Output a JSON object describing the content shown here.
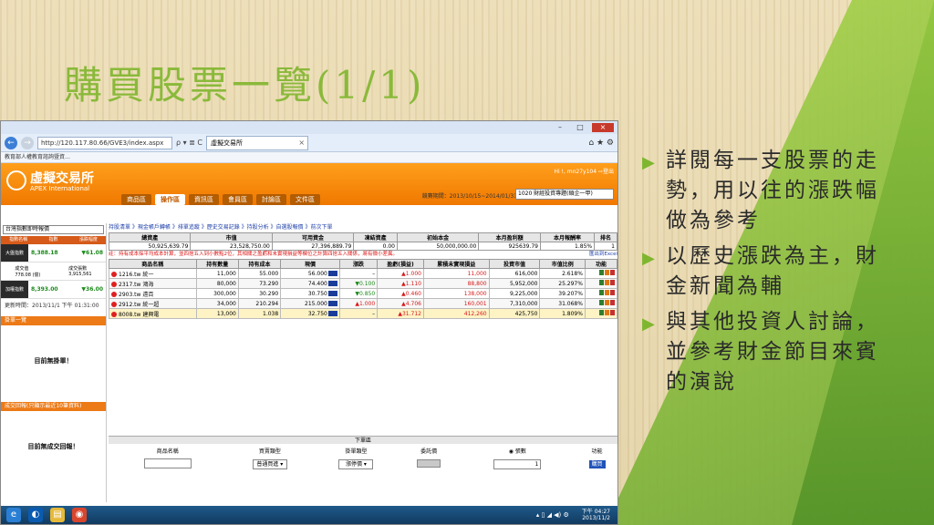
{
  "slide": {
    "title": "購買股票一覽(1/1)",
    "bullets": [
      "詳閱每一支股票的走勢，用以往的漲跌幅做為參考",
      "以歷史漲跌為主，財金新聞為輔",
      "與其他投資人討論，並參考財金節目來賓的演說"
    ]
  },
  "browser": {
    "url": "http://120.117.80.66/GVE3/index.aspx",
    "url_tools": "ρ ▾ ≣ C",
    "tab_title": "虛擬交易所",
    "favorites_text": "教育部人權教育諮詢暨資…",
    "window_buttons": [
      "–",
      "□",
      "×"
    ]
  },
  "site": {
    "logo_name": "虛擬交易所",
    "logo_sub": "APEX International",
    "user_text": "Hi !, mn27y104  ⇨登出",
    "date_range": "競賽期間：2013/10/15~2014/01/31",
    "competition": "1020 財經投資專題(碩企一甲)",
    "menu": [
      "商品區",
      "操作區",
      "資訊區",
      "會員區",
      "討論區",
      "文件區"
    ],
    "active_menu": "操作區"
  },
  "sidebar": {
    "select": "台灣指數即時報價",
    "headers": [
      "指數名稱",
      "指數",
      "漲跌幅度"
    ],
    "rows": [
      {
        "name": "大盤指數",
        "value": "8,388.18",
        "change": "▼61.08",
        "vol_label": "成交值",
        "vol": "778.08 (億)",
        "qty_label": "成交張數",
        "qty": "3,915,561"
      },
      {
        "name": "加權指數",
        "value": "8,393.00",
        "change": "▼36.00"
      }
    ],
    "time": "更新時間：2013/11/1 下午 01:31:00",
    "hold_title": "掛單一覽",
    "hold_empty": "目前無掛單！",
    "trade_title": "成交回報(只顯示最近10筆資料)",
    "trade_empty": "目前無成交回報！"
  },
  "main": {
    "links": "持股清單 》現金帳戶轉帳 》排單追蹤 》歷史交易記錄 》持股分析 》自選股報價 》前次下單",
    "summary_headers": [
      "總資產",
      "市值",
      "可用資金",
      "凍結資產",
      "初始本金",
      "本月盈利額",
      "本月報酬率",
      "排名"
    ],
    "summary_values": [
      "50,925,639.79",
      "23,528,750.00",
      "27,396,889.79",
      "0.00",
      "50,000,000.00",
      "925639.79",
      "1.85%",
      "1"
    ],
    "note": "註：持有成本採平均成本計算，並四捨五入到小數點2位，其相關之盈虧和未實現損益等欄位之計算四捨五入關係，將有微小差異。",
    "export": "匯出到Excel",
    "stock_headers": [
      "商品名稱",
      "持有數量",
      "持有成本",
      "現價",
      "漲跌",
      "盈虧(損益)",
      "累積未實現損益",
      "投資市值",
      "市值比例",
      "功能"
    ],
    "stocks": [
      {
        "name": "1216.tw 統一",
        "qty": "11,000",
        "cost": "55.000",
        "price": "56.000",
        "chg": "–",
        "chg_dir": "flat",
        "pl": "▲1.000",
        "acc": "11,000",
        "mv": "616,000",
        "ratio": "2.618%"
      },
      {
        "name": "2317.tw 鴻海",
        "qty": "80,000",
        "cost": "73.290",
        "price": "74.400",
        "chg": "▼0.100",
        "chg_dir": "dn",
        "pl": "▲1.110",
        "acc": "88,800",
        "mv": "5,952,000",
        "ratio": "25.297%"
      },
      {
        "name": "2903.tw 遠百",
        "qty": "300,000",
        "cost": "30.290",
        "price": "30.750",
        "chg": "▼0.850",
        "chg_dir": "dn",
        "pl": "▲0.460",
        "acc": "138,000",
        "mv": "9,225,000",
        "ratio": "39.207%"
      },
      {
        "name": "2912.tw 統一超",
        "qty": "34,000",
        "cost": "210.294",
        "price": "215.000",
        "chg": "▲1.000",
        "chg_dir": "up",
        "pl": "▲4.706",
        "acc": "160,001",
        "mv": "7,310,000",
        "ratio": "31.068%"
      },
      {
        "name": "8008.tw 建興電",
        "qty": "13,000",
        "cost": "1.038",
        "price": "32.750",
        "chg": "–",
        "chg_dir": "flat",
        "pl": "▲31.712",
        "acc": "412,260",
        "mv": "425,750",
        "ratio": "1.809%"
      }
    ],
    "order_title": "下單區",
    "order_headers": [
      "商品名稱",
      "買賣類型",
      "掛單類型",
      "委託價",
      "◉ 張數",
      "功能"
    ],
    "order_type": "普通買進 ▾",
    "order_kind": "漲停價 ▾",
    "order_qty": "1",
    "order_btn": "購買"
  },
  "taskbar": {
    "clock_time": "下午 04:27",
    "clock_date": "2013/11/2",
    "tray": "▴ ▯ ◢ ◀) ⚙"
  }
}
